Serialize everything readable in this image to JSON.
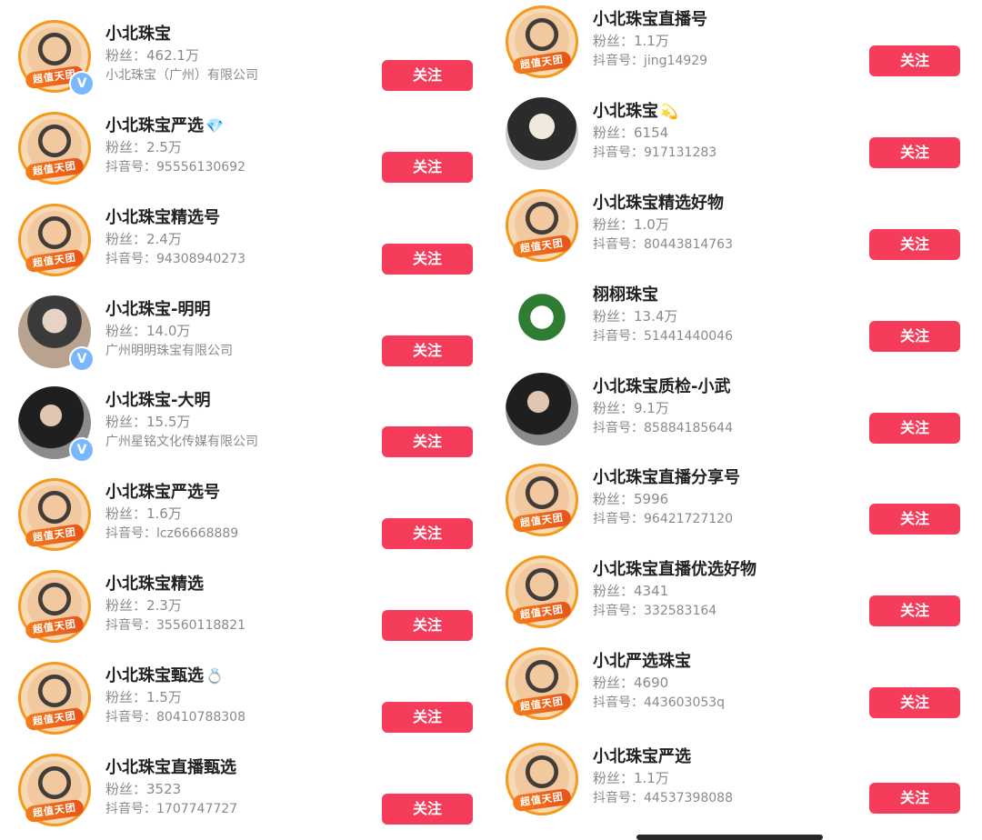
{
  "left": {
    "items": [
      {
        "name": "小北珠宝",
        "fans": "粉丝：462.1万",
        "sub": "小北珠宝（广州）有限公司",
        "button": "关注",
        "avatar_badge": "超值天团",
        "verified": true
      },
      {
        "name": "小北珠宝严选",
        "name_emoji": "💎",
        "fans": "粉丝：2.5万",
        "sub": "抖音号：95556130692",
        "button": "关注",
        "avatar_badge": "超值天团"
      },
      {
        "name": "小北珠宝精选号",
        "fans": "粉丝：2.4万",
        "sub": "抖音号：94308940273",
        "button": "关注",
        "avatar_badge": "超值天团"
      },
      {
        "name": "小北珠宝-明明",
        "fans": "粉丝：14.0万",
        "sub": "广州明明珠宝有限公司",
        "button": "关注",
        "verified": true
      },
      {
        "name": "小北珠宝-大明",
        "fans": "粉丝：15.5万",
        "sub": "广州星铭文化传媒有限公司",
        "button": "关注",
        "verified": true
      },
      {
        "name": "小北珠宝严选号",
        "fans": "粉丝：1.6万",
        "sub": "抖音号：lcz66668889",
        "button": "关注",
        "avatar_badge": "超值天团"
      },
      {
        "name": "小北珠宝精选",
        "fans": "粉丝：2.3万",
        "sub": "抖音号：35560118821",
        "button": "关注",
        "avatar_badge": "超值天团"
      },
      {
        "name": "小北珠宝甄选",
        "name_emoji": "💍",
        "fans": "粉丝：1.5万",
        "sub": "抖音号：80410788308",
        "button": "关注",
        "avatar_badge": "超值天团"
      },
      {
        "name": "小北珠宝直播甄选",
        "fans": "粉丝：3523",
        "sub": "抖音号：1707747727",
        "button": "关注",
        "avatar_badge": "超值天团"
      }
    ]
  },
  "right": {
    "items": [
      {
        "name": "小北珠宝直播号",
        "fans": "粉丝：1.1万",
        "sub": "抖音号：jing14929",
        "button": "关注",
        "avatar_badge": "超值天团"
      },
      {
        "name": "小北珠宝",
        "name_emoji": "💫",
        "fans": "粉丝：6154",
        "sub": "抖音号：917131283",
        "button": "关注"
      },
      {
        "name": "小北珠宝精选好物",
        "fans": "粉丝：1.0万",
        "sub": "抖音号：80443814763",
        "button": "关注",
        "avatar_badge": "超值天团"
      },
      {
        "name": "栩栩珠宝",
        "fans": "粉丝：13.4万",
        "sub": "抖音号：51441440046",
        "button": "关注"
      },
      {
        "name": "小北珠宝质检-小武",
        "fans": "粉丝：9.1万",
        "sub": "抖音号：85884185644",
        "button": "关注"
      },
      {
        "name": "小北珠宝直播分享号",
        "fans": "粉丝：5996",
        "sub": "抖音号：96421727120",
        "button": "关注",
        "avatar_badge": "超值天团"
      },
      {
        "name": "小北珠宝直播优选好物",
        "fans": "粉丝：4341",
        "sub": "抖音号：332583164",
        "button": "关注",
        "avatar_badge": "超值天团"
      },
      {
        "name": "小北严选珠宝",
        "fans": "粉丝：4690",
        "sub": "抖音号：443603053q",
        "button": "关注",
        "avatar_badge": "超值天团"
      },
      {
        "name": "小北珠宝严选",
        "fans": "粉丝：1.1万",
        "sub": "抖音号：44537398088",
        "button": "关注",
        "avatar_badge": "超值天团"
      }
    ]
  },
  "verify_icon_text": "V",
  "colors": {
    "accent": "#f53c5b",
    "meta": "#8a8a8a",
    "badge": "#f47c1c",
    "verify": "#79b8ff"
  }
}
